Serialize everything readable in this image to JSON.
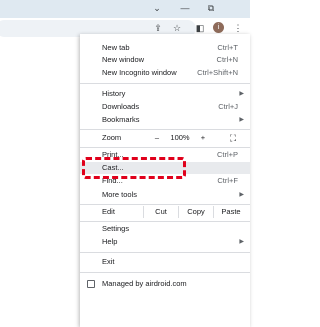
{
  "window": {
    "chevron": "⌄",
    "minimize": "—",
    "restore": "⧉"
  },
  "toolbar": {
    "share_icon": "⇪",
    "star_icon": "☆",
    "sidepanel_icon": "◧",
    "avatar_initial": "i",
    "menu_icon": "⋮"
  },
  "menu": {
    "new_tab": {
      "label": "New tab",
      "shortcut": "Ctrl+T"
    },
    "new_window": {
      "label": "New window",
      "shortcut": "Ctrl+N"
    },
    "new_incognito": {
      "label": "New Incognito window",
      "shortcut": "Ctrl+Shift+N"
    },
    "history": {
      "label": "History"
    },
    "downloads": {
      "label": "Downloads",
      "shortcut": "Ctrl+J"
    },
    "bookmarks": {
      "label": "Bookmarks"
    },
    "zoom": {
      "label": "Zoom",
      "minus": "–",
      "value": "100%",
      "plus": "+",
      "fullscreen_icon": "⛶"
    },
    "print": {
      "label": "Print...",
      "shortcut": "Ctrl+P"
    },
    "cast": {
      "label": "Cast..."
    },
    "find": {
      "label": "Find...",
      "shortcut": "Ctrl+F"
    },
    "more_tools": {
      "label": "More tools"
    },
    "edit": {
      "label": "Edit",
      "cut": "Cut",
      "copy": "Copy",
      "paste": "Paste"
    },
    "settings": {
      "label": "Settings"
    },
    "help": {
      "label": "Help"
    },
    "exit": {
      "label": "Exit"
    },
    "managed": {
      "label": "Managed by airdroid.com"
    }
  },
  "submenu_arrow": "▶",
  "highlight_color": "#e0001b"
}
